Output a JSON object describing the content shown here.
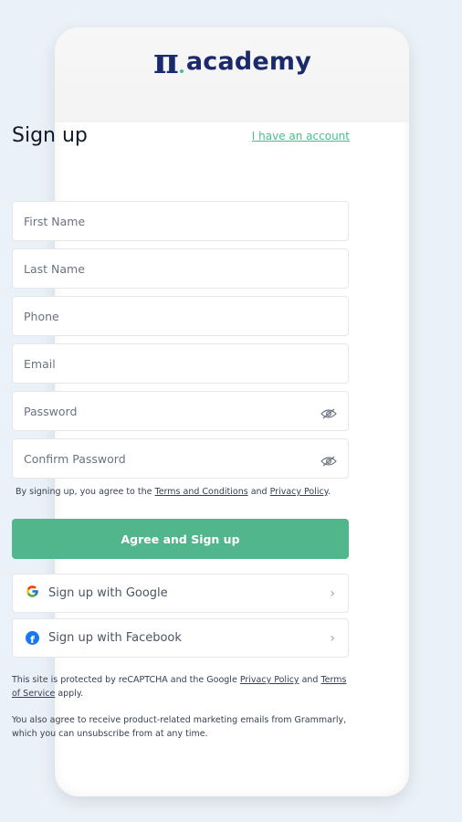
{
  "brand": {
    "symbol": "π",
    "name": "academy"
  },
  "page": {
    "title": "Sign up",
    "login_link": "I have an account"
  },
  "fields": {
    "first_name": "First Name",
    "last_name": "Last Name",
    "phone": "Phone",
    "email": "Email",
    "password": "Password",
    "confirm_password": "Confirm Password"
  },
  "terms": {
    "prefix": "By signing up, you agree to the ",
    "terms_link": "Terms and Conditions",
    "and": " and ",
    "privacy_link": "Privacy Policy",
    "suffix": "."
  },
  "primary_button": "Agree and Sign up",
  "social": {
    "google": "Sign up with Google",
    "facebook": "Sign up with Facebook"
  },
  "recaptcha": {
    "prefix": "This site is protected by reCAPTCHA and the Google ",
    "privacy_link": "Privacy Policy",
    "and": " and ",
    "terms_link": "Terms of Service",
    "suffix": " apply."
  },
  "marketing_note": "You also agree to receive product-related marketing emails from Grammarly, which you can unsubscribe from at any time.",
  "colors": {
    "accent": "#52b68d",
    "brand": "#1b2a6b",
    "facebook": "#1877f2"
  },
  "icons": {
    "password_toggle": "eye-off-icon",
    "chevron": "chevron-right-icon"
  }
}
